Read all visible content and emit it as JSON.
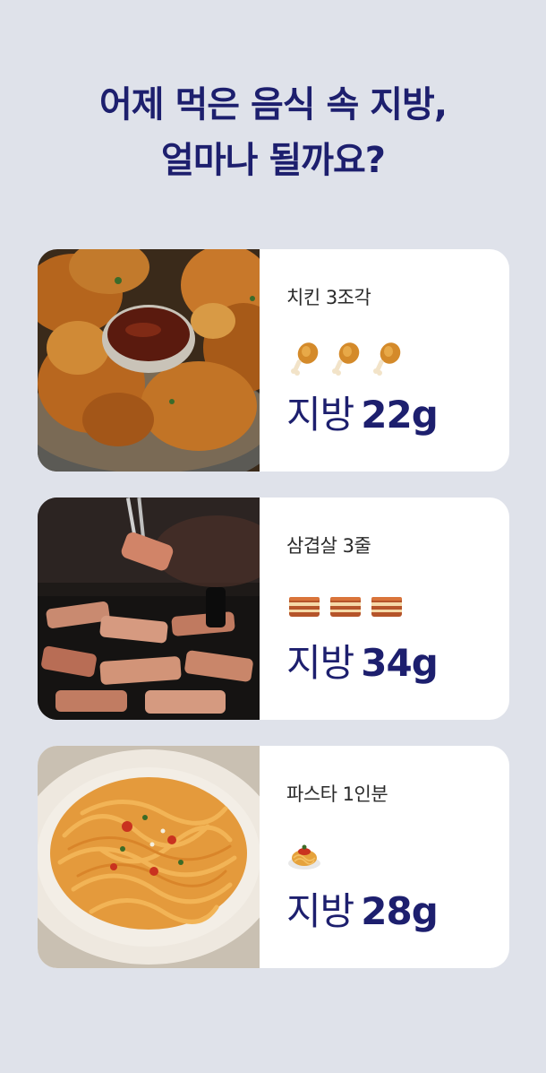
{
  "headline": {
    "line1": "어제 먹은 음식 속 지방,",
    "line2": "얼마나 될까요?"
  },
  "colors": {
    "background": "#dfe2ea",
    "accent": "#1d1f6e",
    "card": "#ffffff"
  },
  "cards": [
    {
      "name": "치킨 3조각",
      "fat_label": "지방",
      "fat_value": "22g",
      "emoji": "poultry-leg-icon",
      "emoji_count": 3,
      "photo": "fried-chicken-photo"
    },
    {
      "name": "삼겹살 3줄",
      "fat_label": "지방",
      "fat_value": "34g",
      "emoji": "bacon-icon",
      "emoji_count": 3,
      "photo": "grilled-pork-belly-photo"
    },
    {
      "name": "파스타 1인분",
      "fat_label": "지방",
      "fat_value": "28g",
      "emoji": "spaghetti-icon",
      "emoji_count": 1,
      "photo": "pasta-plate-photo"
    }
  ]
}
